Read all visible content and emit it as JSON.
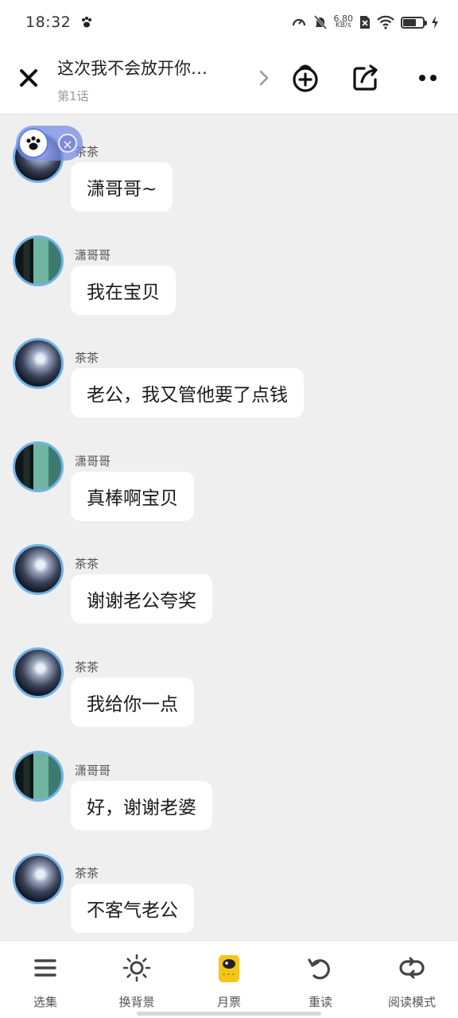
{
  "status_bar": {
    "time": "18:32",
    "net_speed_value": "6.80",
    "net_speed_unit": "KB/s",
    "battery_level": 0.6
  },
  "header": {
    "title": "这次我不会放开你…",
    "episode": "第1话"
  },
  "messages": [
    {
      "sender": "茶茶",
      "text": "潇哥哥~",
      "avatar": "tea"
    },
    {
      "sender": "潇哥哥",
      "text": "我在宝贝",
      "avatar": "xiao"
    },
    {
      "sender": "茶茶",
      "text": "老公，我又管他要了点钱",
      "avatar": "tea"
    },
    {
      "sender": "潇哥哥",
      "text": "真棒啊宝贝",
      "avatar": "xiao"
    },
    {
      "sender": "茶茶",
      "text": "谢谢老公夸奖",
      "avatar": "tea"
    },
    {
      "sender": "茶茶",
      "text": "我给你一点",
      "avatar": "tea"
    },
    {
      "sender": "潇哥哥",
      "text": "好，谢谢老婆",
      "avatar": "xiao"
    },
    {
      "sender": "茶茶",
      "text": "不客气老公",
      "avatar": "tea"
    }
  ],
  "bottom_nav": [
    {
      "label": "选集",
      "icon": "list-icon"
    },
    {
      "label": "换背景",
      "icon": "sun-icon"
    },
    {
      "label": "月票",
      "icon": "monthly-ticket-icon"
    },
    {
      "label": "重读",
      "icon": "reread-icon"
    },
    {
      "label": "阅读模式",
      "icon": "reading-mode-icon"
    }
  ],
  "colors": {
    "background": "#efeff0",
    "bubble": "#ffffff",
    "avatar_ring": "#6fb3e8",
    "float_widget": "#788ce6",
    "ticket": "#f5c518"
  }
}
